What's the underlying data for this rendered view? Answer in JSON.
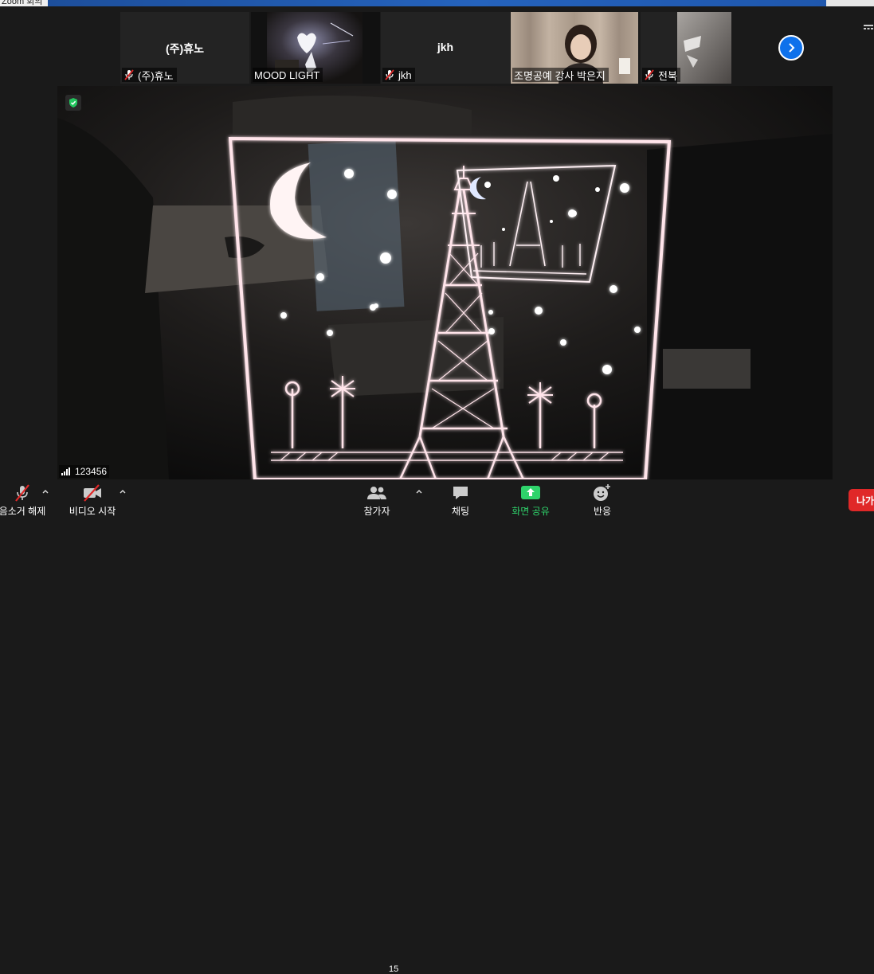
{
  "window": {
    "title": "Zoom 회의"
  },
  "participants_strip": {
    "tiles": [
      {
        "name": "(주)휴노",
        "label": "(주)휴노",
        "muted": true,
        "video": false
      },
      {
        "name": "MOOD LIGHT",
        "label": "MOOD LIGHT",
        "muted": false,
        "video": true
      },
      {
        "name": "jkh",
        "label": "jkh",
        "muted": true,
        "video": false
      },
      {
        "name": "조명공예 강사 박은지",
        "label": "조명공예 강사 박은지",
        "muted": false,
        "video": true
      },
      {
        "name": "전북",
        "label": "전북",
        "muted": true,
        "video": true
      }
    ],
    "next_icon": "chevron-right-icon"
  },
  "main_video": {
    "speaker_name": "123456",
    "encryption_icon": "shield-check-icon"
  },
  "toolbar": {
    "unmute_label": "음소거 해제",
    "start_video_label": "비디오 시작",
    "participants_label": "참가자",
    "participants_count": "15",
    "chat_label": "채팅",
    "share_label": "화면 공유",
    "reactions_label": "반응",
    "leave_label": "나가"
  },
  "colors": {
    "accent_blue": "#0e71eb",
    "share_green": "#2fd36b",
    "leave_red": "#e02828",
    "mute_red": "#e02828"
  }
}
